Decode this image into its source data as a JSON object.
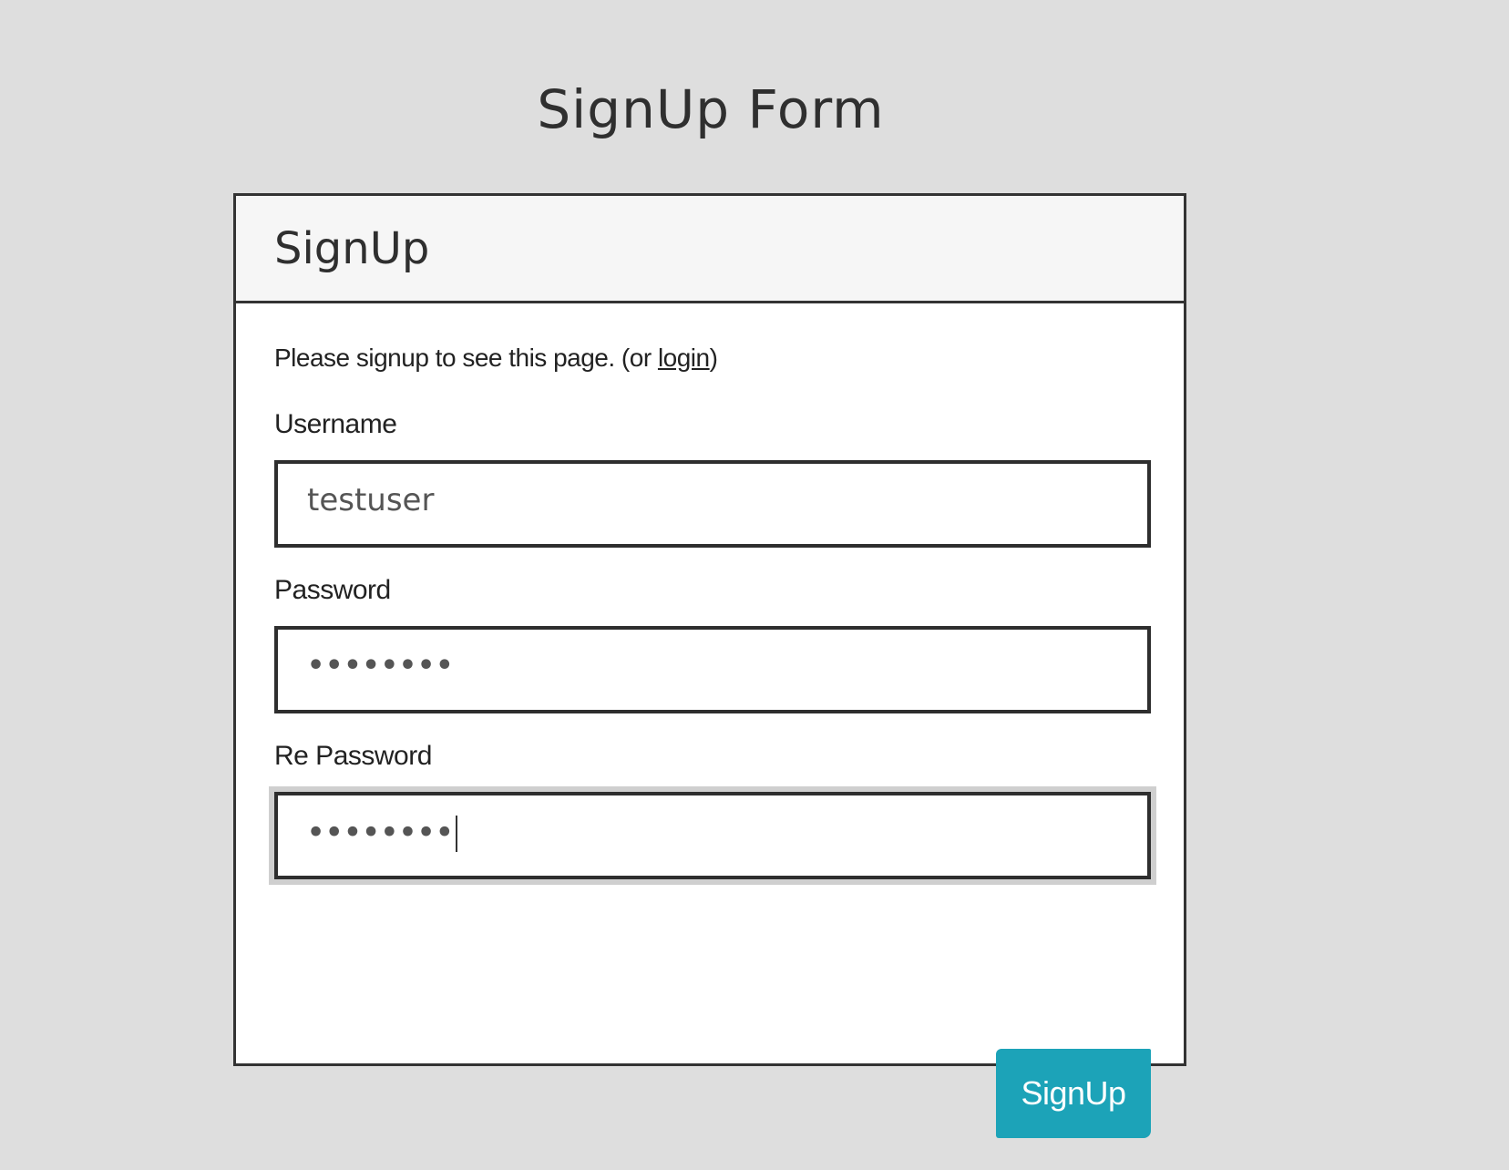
{
  "page": {
    "title": "SignUp Form"
  },
  "panel": {
    "heading": "SignUp",
    "intro_text": "Please signup to see this page. (or ",
    "intro_link": "login",
    "intro_suffix": ")"
  },
  "form": {
    "username": {
      "label": "Username",
      "value": "testuser"
    },
    "password": {
      "label": "Password",
      "value": "••••••••"
    },
    "re_password": {
      "label": "Re Password",
      "value": "••••••••"
    },
    "submit_label": "SignUp"
  },
  "colors": {
    "background": "#dedede",
    "button": "#1ca3b8",
    "border": "#333333"
  }
}
